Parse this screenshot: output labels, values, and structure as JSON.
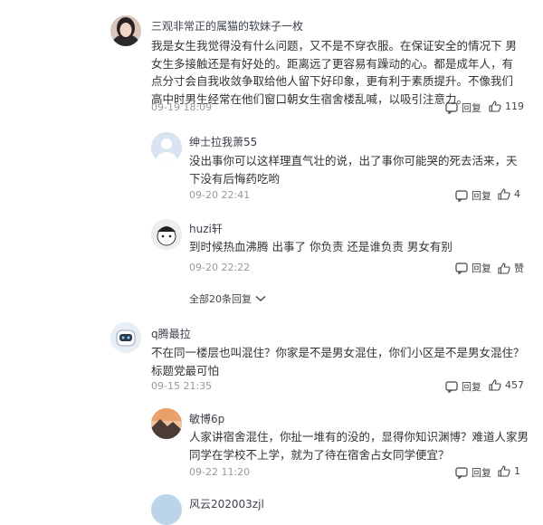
{
  "comments": [
    {
      "name": "三观非常正的属猫的软妹子一枚",
      "text": "我是女生我觉得没有什么问题，又不是不穿衣服。在保证安全的情况下 男女生多接触还是有好处的。距离远了更容易有躁动的心。都是成年人，有点分寸会自我收敛争取给他人留下好印象，更有利于素质提升。不像我们高中时男生经常在他们窗口朝女生宿舍楼乱喊，以吸引注意力。",
      "time": "09-19 18:09",
      "reply_label": "回复",
      "likes": "119",
      "avatar_icon": "woman-portrait-avatar"
    },
    {
      "name": "绅士拉我萧55",
      "text": "没出事你可以这样理直气壮的说，出了事你可能哭的死去活来，天下没有后悔药吃哟",
      "time": "09-20 22:41",
      "reply_label": "回复",
      "likes": "4",
      "avatar_icon": "default-user-avatar"
    },
    {
      "name": "huzi轩",
      "text": "到时候热血沸腾 出事了 你负责 还是谁负责 男女有别",
      "time": "09-20 22:22",
      "reply_label": "回复",
      "likes": "赞",
      "avatar_icon": "cartoon-avatar"
    },
    {
      "name": "q腾最拉",
      "text": "不在同一楼层也叫混住？你家是不是男女混住，你们小区是不是男女混住？标题党最可怕",
      "time": "09-15 21:35",
      "reply_label": "回复",
      "likes": "457",
      "avatar_icon": "robot-avatar"
    },
    {
      "name": "敏博6p",
      "text": "人家讲宿舍混住，你扯一堆有的没的，显得你知识渊博？难道人家男同学在学校不上学，就为了待在宿舍占女同学便宜？",
      "time": "09-22 11:20",
      "reply_label": "回复",
      "likes": "1",
      "avatar_icon": "sunset-avatar"
    },
    {
      "name": "风云202003zjl"
    }
  ],
  "more_replies": "全部20条回复",
  "colors": {
    "name": "#3a3f4a",
    "time": "#999999",
    "text": "#333333"
  }
}
